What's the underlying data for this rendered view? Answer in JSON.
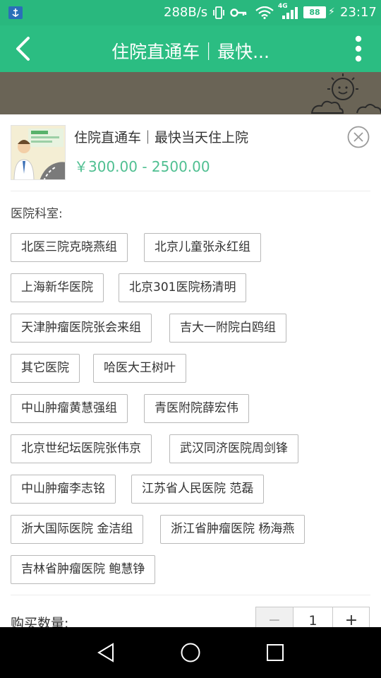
{
  "status_bar": {
    "network_speed": "288B/s",
    "network_type": "4G",
    "battery_level": "88",
    "time": "23:17",
    "icons": [
      "app-notification-icon",
      "vibrate-icon",
      "key-icon",
      "wifi-icon",
      "signal-icon",
      "battery-icon",
      "charging-icon"
    ]
  },
  "app_bar": {
    "title": "住院直通车｜最快...",
    "back_icon": "back-arrow-icon",
    "more_icon": "more-vertical-icon"
  },
  "product": {
    "title": "住院直通车｜最快当天住上院",
    "price": "￥300.00 - 2500.00",
    "thumbnail_icon": "doctor-thumbnail"
  },
  "options": {
    "label": "医院科室:",
    "items": [
      "北医三院克晓燕组",
      "北京儿童张永红组",
      "上海新华医院",
      "北京301医院杨清明",
      "天津肿瘤医院张会来组",
      "吉大一附院白鸥组",
      "其它医院",
      "哈医大王树叶",
      "中山肿瘤黄慧强组",
      "青医附院薛宏伟",
      "北京世纪坛医院张伟京",
      "武汉同济医院周剑锋",
      "中山肿瘤李志铭",
      "江苏省人民医院 范磊",
      "浙大国际医院 金洁组",
      "浙江省肿瘤医院 杨海燕",
      "吉林省肿瘤医院 鲍慧铮"
    ]
  },
  "quantity": {
    "label": "购买数量:",
    "value": "1",
    "minus": "−",
    "plus": "+"
  },
  "colors": {
    "accent": "#2bbd82",
    "price": "#4fbf91"
  }
}
